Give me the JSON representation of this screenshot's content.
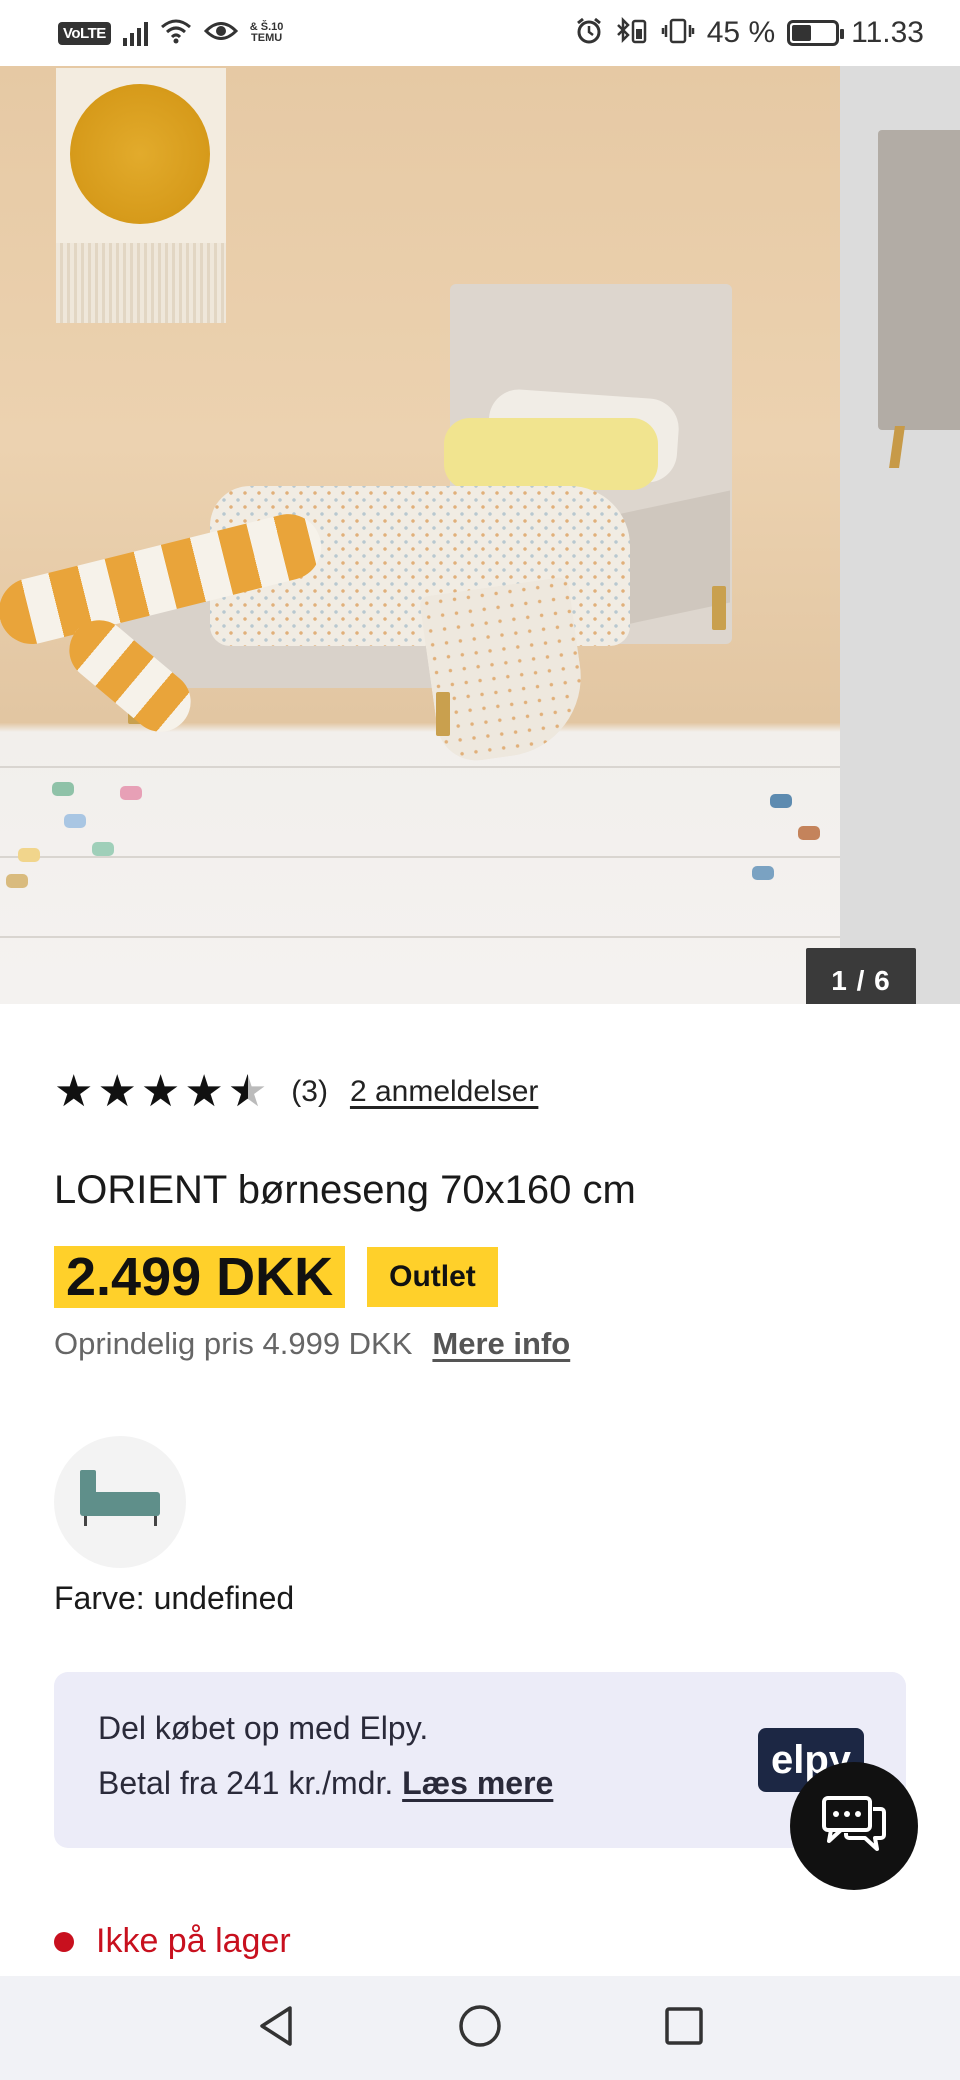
{
  "status_bar": {
    "volte": "VoLTE",
    "temu_line1": "& Š.10",
    "temu_line2": "TEMU",
    "battery_percent": "45 %",
    "battery_level": 0.45,
    "time": "11.33"
  },
  "gallery": {
    "counter": "1 / 6"
  },
  "product": {
    "rating_value": 4.5,
    "rating_count": "(3)",
    "reviews_link": "2 anmeldelser",
    "title": "LORIENT børneseng 70x160 cm",
    "price": "2.499 DKK",
    "badge": "Outlet",
    "original_price": "Oprindelig pris 4.999 DKK",
    "more_info": "Mere info",
    "color_label": "Farve: undefined",
    "swatch_color": "#5f8f8a"
  },
  "financing": {
    "line1": "Del købet op med Elpy.",
    "line2_prefix": "Betal fra 241 kr./mdr.",
    "read_more": "Læs mere",
    "logo": "elpy"
  },
  "stock": {
    "status": "Ikke på lager",
    "color": "#c8101e"
  },
  "colors": {
    "price_highlight": "#ffd02a",
    "elpy_bg": "#ececf8",
    "chat_button": "#111111"
  },
  "nav": {
    "back": "back-icon",
    "home": "home-icon",
    "recents": "recents-icon"
  }
}
